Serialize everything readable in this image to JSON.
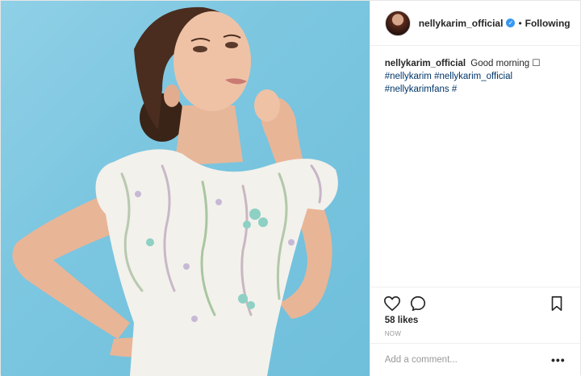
{
  "post": {
    "username": "nellykarim_official",
    "follow_separator": "•",
    "follow_status": "Following",
    "verified_icon": "verified-badge-icon",
    "caption": {
      "user": "nellykarim_official",
      "text": "Good morning ☐",
      "hashtags": [
        "#nellykarim",
        "#nellykarim_official",
        "#nellykarimfans",
        "#"
      ]
    },
    "likes": "58 likes",
    "timestamp": "NOW",
    "comment_placeholder": "Add a comment...",
    "more_label": "•••",
    "icons": {
      "like": "heart-icon",
      "comment": "comment-bubble-icon",
      "save": "bookmark-icon"
    },
    "colors": {
      "background_sky": "#7cc6e0",
      "verified": "#3897f0",
      "hashtag": "#003569"
    }
  }
}
